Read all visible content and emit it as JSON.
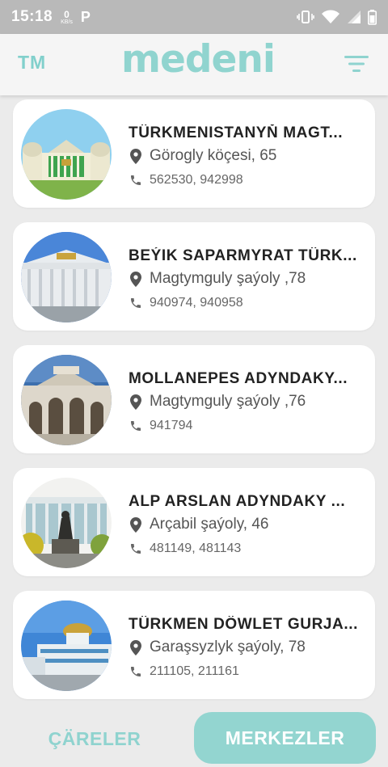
{
  "status_bar": {
    "time": "15:18",
    "speed_value": "0",
    "speed_unit": "KB/s",
    "app_indicator": "P",
    "icons": [
      "vibrate-icon",
      "wifi-icon",
      "signal-icon",
      "battery-icon"
    ]
  },
  "header": {
    "lang_label": "TM",
    "brand": "medeni",
    "filter_icon": "filter-icon"
  },
  "colors": {
    "accent": "#93d5d0",
    "background": "#ebebeb",
    "card": "#ffffff",
    "title_text": "#222222",
    "meta_text": "#555555"
  },
  "venues": [
    {
      "title": "TÜRKMENISTANYŇ MAGT...",
      "address": "Görogly köçesi, 65",
      "phone": "562530, 942998"
    },
    {
      "title": "BEÝIK SAPARMYRAT TÜRK...",
      "address": "Magtymguly şaýoly ,78",
      "phone": "940974, 940958"
    },
    {
      "title": "MOLLANEPES ADYNDAKY...",
      "address": "Magtymguly şaýoly ,76",
      "phone": "941794"
    },
    {
      "title": "ALP ARSLAN ADYNDAKY ...",
      "address": "Arçabil şaýoly, 46",
      "phone": "481149, 481143"
    },
    {
      "title": "TÜRKMEN DÖWLET GURJA...",
      "address": "Garaşsyzlyk şaýoly, 78",
      "phone": "211105, 211161"
    }
  ],
  "bottom_tabs": {
    "left_label": "ÇÄRELER",
    "right_label": "MERKEZLER",
    "active": "MERKEZLER"
  }
}
